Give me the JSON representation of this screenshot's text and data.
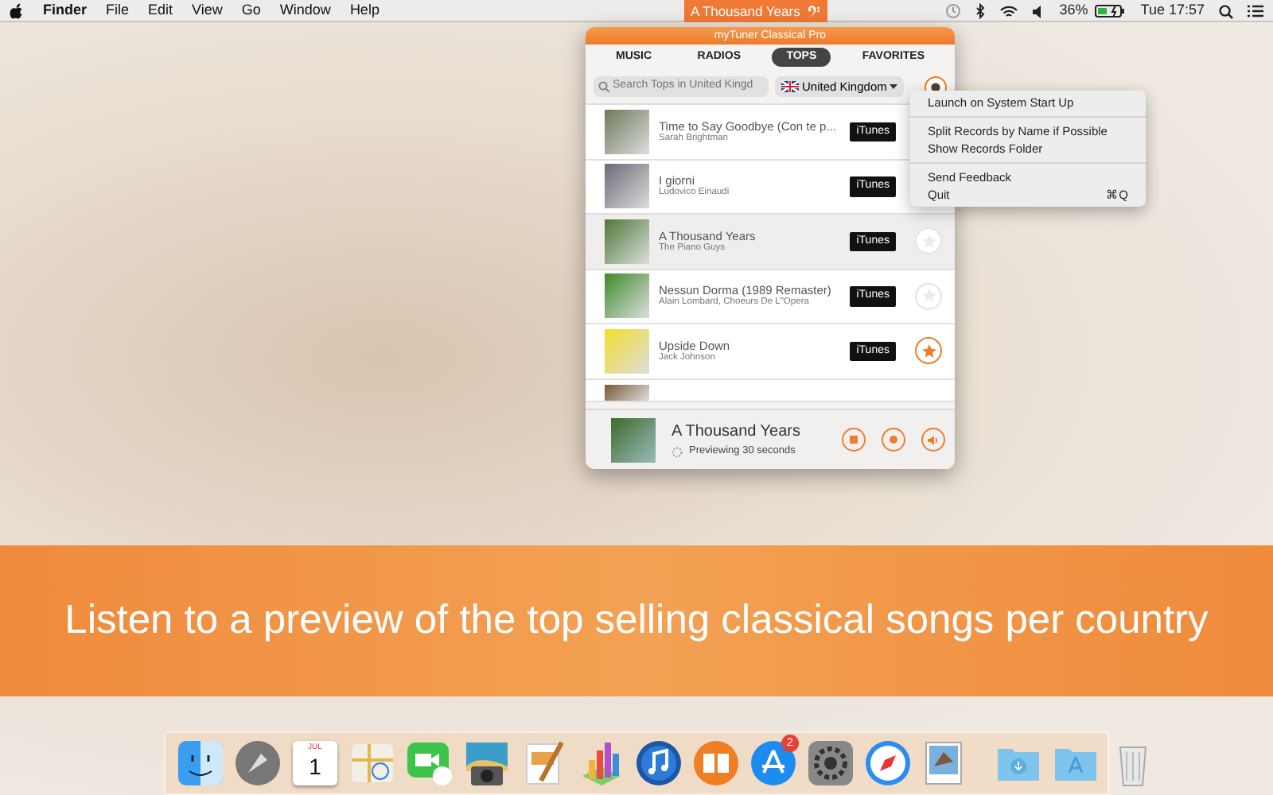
{
  "menu_bar": {
    "app": "Finder",
    "menus": [
      "File",
      "Edit",
      "View",
      "Go",
      "Window",
      "Help"
    ],
    "now_playing": "A Thousand Years",
    "battery": "36%",
    "clock": "Tue 17:57"
  },
  "app_window": {
    "title": "myTuner Classical Pro",
    "tabs": [
      {
        "label": "MUSIC",
        "selected": false
      },
      {
        "label": "RADIOS",
        "selected": false
      },
      {
        "label": "TOPS",
        "selected": true
      },
      {
        "label": "FAVORITES",
        "selected": false
      }
    ],
    "search": {
      "placeholder": "Search Tops in United Kingd"
    },
    "country": "United Kingdom",
    "rows": [
      {
        "title": "Time to Say Goodbye (Con te p...",
        "artist": "Sarah Brightman",
        "store": "iTunes",
        "selected": false
      },
      {
        "title": "I giorni",
        "artist": "Ludovico Einaudi",
        "store": "iTunes",
        "selected": false
      },
      {
        "title": "A Thousand Years",
        "artist": "The Piano Guys",
        "store": "iTunes",
        "favorite": false,
        "selected": true
      },
      {
        "title": "Nessun Dorma (1989 Remaster)",
        "artist": "Alain Lombard, Choeurs De L\"Opera",
        "store": "iTunes",
        "favorite": false,
        "selected": false
      },
      {
        "title": "Upside Down",
        "artist": "Jack Johnson",
        "store": "iTunes",
        "favorite": true,
        "selected": false
      }
    ],
    "player": {
      "title": "A Thousand Years",
      "status": "Previewing 30 seconds"
    }
  },
  "dropdown_menu": [
    {
      "kind": "item",
      "label": "Launch on System Start Up"
    },
    {
      "kind": "separator"
    },
    {
      "kind": "item",
      "label": "Split Records by Name if Possible"
    },
    {
      "kind": "item",
      "label": "Show Records Folder"
    },
    {
      "kind": "separator"
    },
    {
      "kind": "item",
      "label": "Send Feedback"
    },
    {
      "kind": "item",
      "label": "Quit",
      "shortcut": "⌘Q"
    }
  ],
  "banner": "Listen to a preview of the top selling classical songs per country",
  "dock": {
    "calendar_month": "JUL",
    "calendar_day": "1",
    "app_store_badge": "2"
  }
}
